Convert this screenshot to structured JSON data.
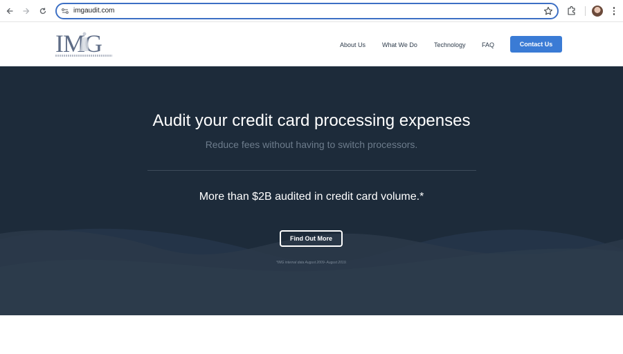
{
  "browser": {
    "url": "imgaudit.com",
    "icons": [
      "back-arrow-icon",
      "forward-arrow-icon",
      "reload-icon",
      "site-info-icon",
      "bookmark-star-icon",
      "extensions-puzzle-icon",
      "profile-avatar",
      "menu-dots-icon"
    ]
  },
  "header": {
    "logo_text": "IMG",
    "nav": [
      {
        "label": "About Us"
      },
      {
        "label": "What We Do"
      },
      {
        "label": "Technology"
      },
      {
        "label": "FAQ"
      }
    ],
    "contact_label": "Contact Us",
    "accent_color": "#3a7bd5"
  },
  "hero": {
    "title": "Audit your credit card processing expenses",
    "subtitle": "Reduce fees without having to switch processors.",
    "stat": "More than $2B audited in credit card volume.*",
    "cta_label": "Find Out More",
    "footnote": "*IMG internal data August 2009- August 2019.",
    "background_color": "#1d2b3a",
    "wave_color": "#2b3a4a"
  }
}
